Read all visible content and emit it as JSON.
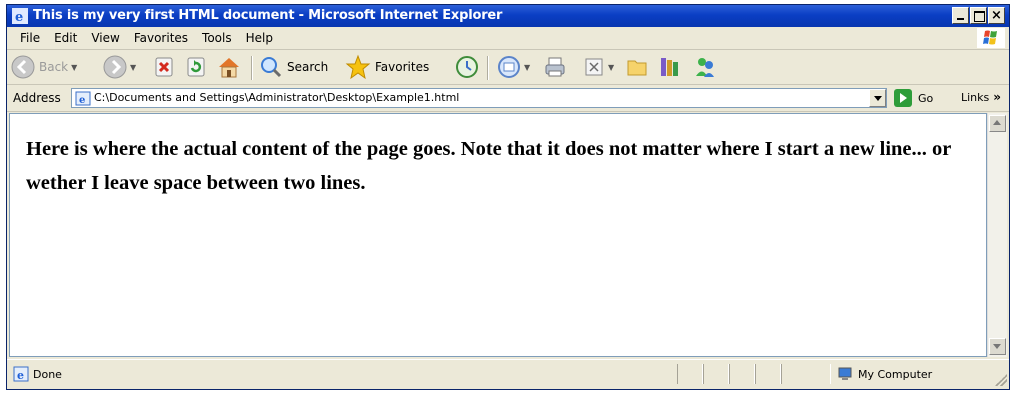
{
  "window": {
    "title": "This is my very first HTML document - Microsoft Internet Explorer",
    "controls": [
      "minimize",
      "maximize",
      "close"
    ]
  },
  "menu": {
    "items": [
      "File",
      "Edit",
      "View",
      "Favorites",
      "Tools",
      "Help"
    ]
  },
  "toolbar": {
    "back_label": "Back",
    "search_label": "Search",
    "favorites_label": "Favorites",
    "icons": [
      "back-icon",
      "forward-icon",
      "stop-icon",
      "refresh-icon",
      "home-icon",
      "search-icon",
      "favorites-icon",
      "history-icon",
      "mail-icon",
      "print-icon",
      "edit-icon",
      "folder-icon",
      "research-icon",
      "messenger-icon"
    ]
  },
  "address": {
    "label": "Address",
    "value": "C:\\Documents and Settings\\Administrator\\Desktop\\Example1.html",
    "go_label": "Go",
    "links_label": "Links"
  },
  "page": {
    "content": "Here is where the actual content of the page goes. Note that it does not matter where I start a new line... or wether I leave space between two lines."
  },
  "status": {
    "text": "Done",
    "zone": "My Computer"
  },
  "colors": {
    "titlebar": "#0a3ec4",
    "chrome": "#ece9d8",
    "go_green": "#2e9d3a"
  }
}
